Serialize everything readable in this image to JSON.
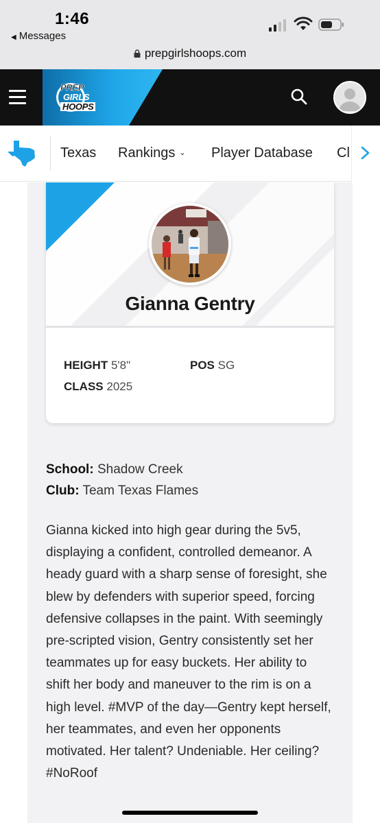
{
  "status_bar": {
    "time": "1:46",
    "back_label": "Messages",
    "url": "prepgirlshoops.com"
  },
  "header": {
    "logo_line1": "PREP",
    "logo_line2": "GIRLS",
    "logo_line3": "HOOPS",
    "menu_icon": "hamburger-icon",
    "search_icon": "search-icon",
    "account_icon": "user-avatar-icon",
    "accent_color": "#1fa7ea"
  },
  "nav": {
    "state_icon": "texas-map-icon",
    "items": [
      {
        "label": "Texas"
      },
      {
        "label": "Rankings"
      },
      {
        "label": "Player Database"
      },
      {
        "label": "Cl"
      }
    ],
    "next_icon": "chevron-right-icon"
  },
  "player": {
    "name": "Gianna Gentry",
    "height_label": "HEIGHT",
    "height_value": "5'8\"",
    "pos_label": "POS",
    "pos_value": "SG",
    "class_label": "CLASS",
    "class_value": "2025"
  },
  "details": {
    "school_label": "School:",
    "school_value": "Shadow Creek",
    "club_label": "Club:",
    "club_value": "Team Texas Flames"
  },
  "bio": "Gianna kicked into high gear during the 5v5, displaying a confident, controlled demeanor. A heady guard with a sharp sense of foresight, she blew by defenders with superior speed, forcing defensive collapses in the paint. With seemingly pre-scripted vision, Gentry consistently set her teammates up for easy buckets. Her ability to shift her body and maneuver to the rim is on a high level. #MVP of the day—Gentry kept herself, her teammates, and even her opponents motivated. Her talent? Undeniable. Her ceiling? #NoRoof"
}
